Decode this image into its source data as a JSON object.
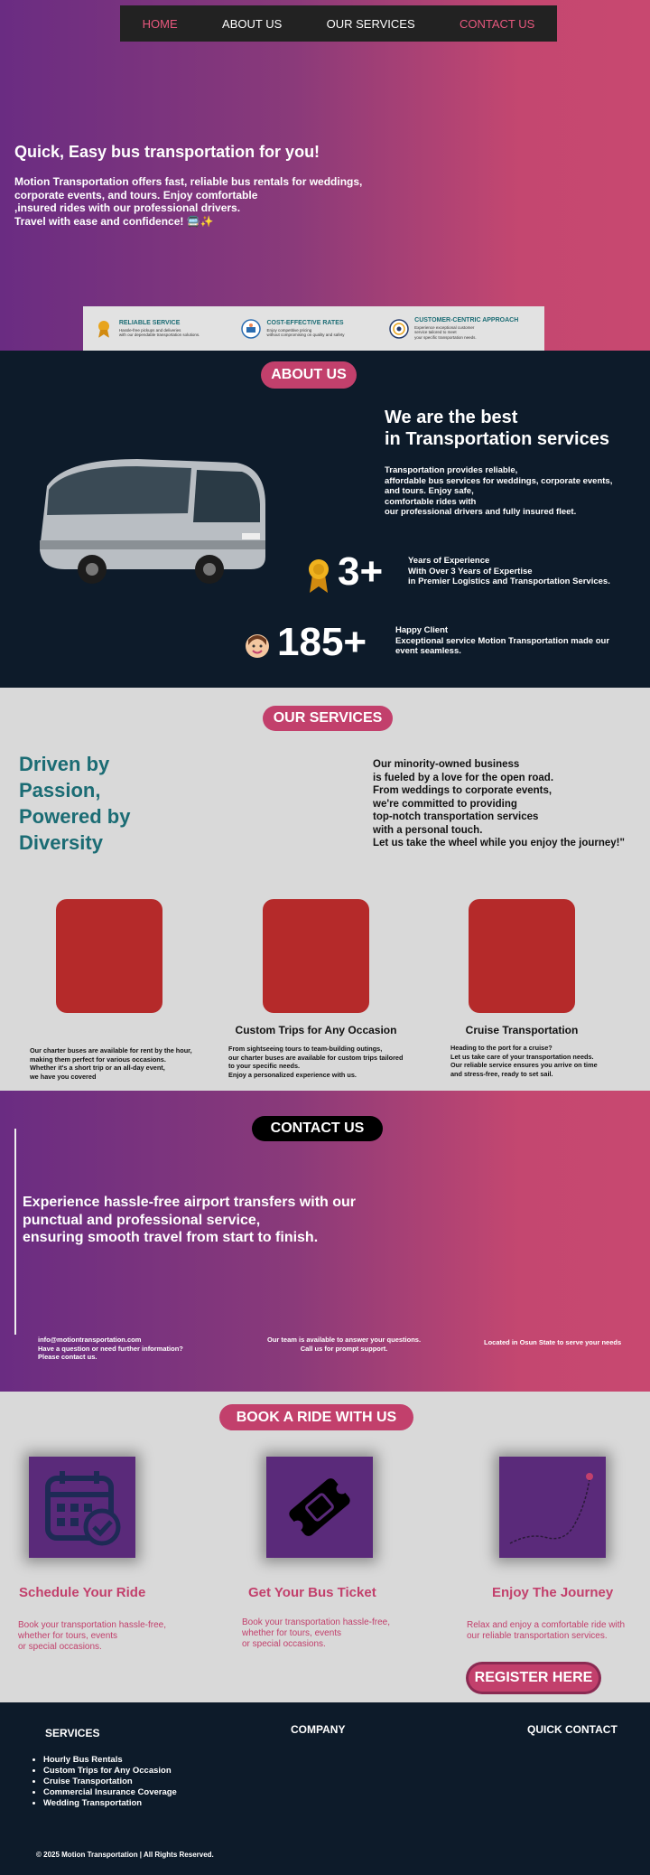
{
  "nav": {
    "items": [
      {
        "label": "HOME",
        "active": true
      },
      {
        "label": "ABOUT US",
        "active": false
      },
      {
        "label": "OUR SERVICES",
        "active": false
      },
      {
        "label": "CONTACT US",
        "active": true
      }
    ]
  },
  "hero": {
    "title": "Quick, Easy bus transportation for you!",
    "description": "Motion Transportation offers fast, reliable bus rentals for weddings,\ncorporate events, and tours. Enjoy comfortable\n,insured rides with our professional drivers.\nTravel with ease and confidence! 🚍✨"
  },
  "features": [
    {
      "title": "RELIABLE SERVICE",
      "desc": "Hassle-free pickups and deliveries\nwith our dependable transportation solutions.",
      "icon": "medal-icon"
    },
    {
      "title": "COST-EFFECTIVE RATES",
      "desc": "Enjoy competitive pricing\nwithout compromising on quality and safety",
      "icon": "rates-icon"
    },
    {
      "title": "CUSTOMER-CENTRIC APPROACH",
      "desc": "Experience exceptional customer\nservice tailored to meet\nyour specific transportation needs.",
      "icon": "customer-icon"
    }
  ],
  "about": {
    "pill": "ABOUT US",
    "title": "We are the best\n in Transportation services",
    "description": "Transportation provides reliable,\n affordable bus services for weddings, corporate events,\nand tours. Enjoy safe,\n comfortable rides with\n our professional drivers and fully insured fleet.",
    "stat1_number": "3+",
    "stat1_text": "Years of Experience\nWith Over 3 Years of Expertise\nin Premier Logistics and Transportation Services.",
    "stat2_number": "185+",
    "stat2_text": "Happy Client\nExceptional service Motion Transportation made our\nevent seamless."
  },
  "services": {
    "pill": "OUR SERVICES",
    "slogan": "Driven by\nPassion,\nPowered by\n Diversity",
    "mission": "Our minority-owned business\n is fueled by a love for the open road.\n From weddings to corporate events,\nwe're committed to providing\ntop-notch transportation services\nwith a personal touch.\nLet us take the wheel while you enjoy the journey!\"",
    "cards": [
      {
        "title": "",
        "desc": "Our charter buses are available for rent by the hour,\nmaking them perfect for various occasions.\nWhether it's a short trip or an all-day event,\n we have you covered"
      },
      {
        "title": "Custom Trips for Any Occasion",
        "desc": "From sightseeing tours to team-building outings,\n our charter buses are available for custom trips tailored\nto your specific needs.\nEnjoy a personalized experience with us."
      },
      {
        "title": "Cruise Transportation",
        "desc": "Heading to the port for a cruise?\n Let us take care of your transportation needs.\nOur reliable service ensures you arrive on time\n and stress-free, ready to set sail."
      }
    ]
  },
  "contact": {
    "pill": "CONTACT US",
    "text": "Experience hassle-free airport transfers with our\npunctual and professional service,\nensuring smooth travel from start to finish.",
    "info1": "info@motiontransportation.com\nHave a question or need further information?\n Please contact us.",
    "info2": "Our team is available to answer your questions.\nCall us for prompt support.",
    "info3": "Located in Osun State to serve your needs"
  },
  "book": {
    "pill": "BOOK A RIDE WITH US",
    "steps": [
      {
        "title": "Schedule Your Ride",
        "desc": "Book your transportation hassle-free,\nwhether for tours, events\nor special occasions.",
        "icon": "calendar-icon"
      },
      {
        "title": "Get Your Bus Ticket",
        "desc": "Book your transportation hassle-free,\nwhether for tours, events\nor special occasions.",
        "icon": "ticket-icon"
      },
      {
        "title": "Enjoy The Journey",
        "desc": "Relax and enjoy a comfortable ride with\nour reliable transportation services.",
        "icon": "route-icon"
      }
    ],
    "register": "REGISTER HERE"
  },
  "footer": {
    "services_heading": "SERVICES",
    "company_heading": "COMPANY",
    "quick_contact_heading": "QUICK CONTACT",
    "services_list": [
      "Hourly Bus Rentals",
      "Custom Trips for Any Occasion",
      "Cruise Transportation",
      "Commercial Insurance Coverage",
      "Wedding Transportation"
    ],
    "copyright": "© 2025 Motion Transportation | All Rights Reserved."
  },
  "colors": {
    "accent": "#c2406c",
    "teal": "#1b6c74",
    "dark": "#0d1b2a",
    "card_red": "#b52a2a"
  }
}
